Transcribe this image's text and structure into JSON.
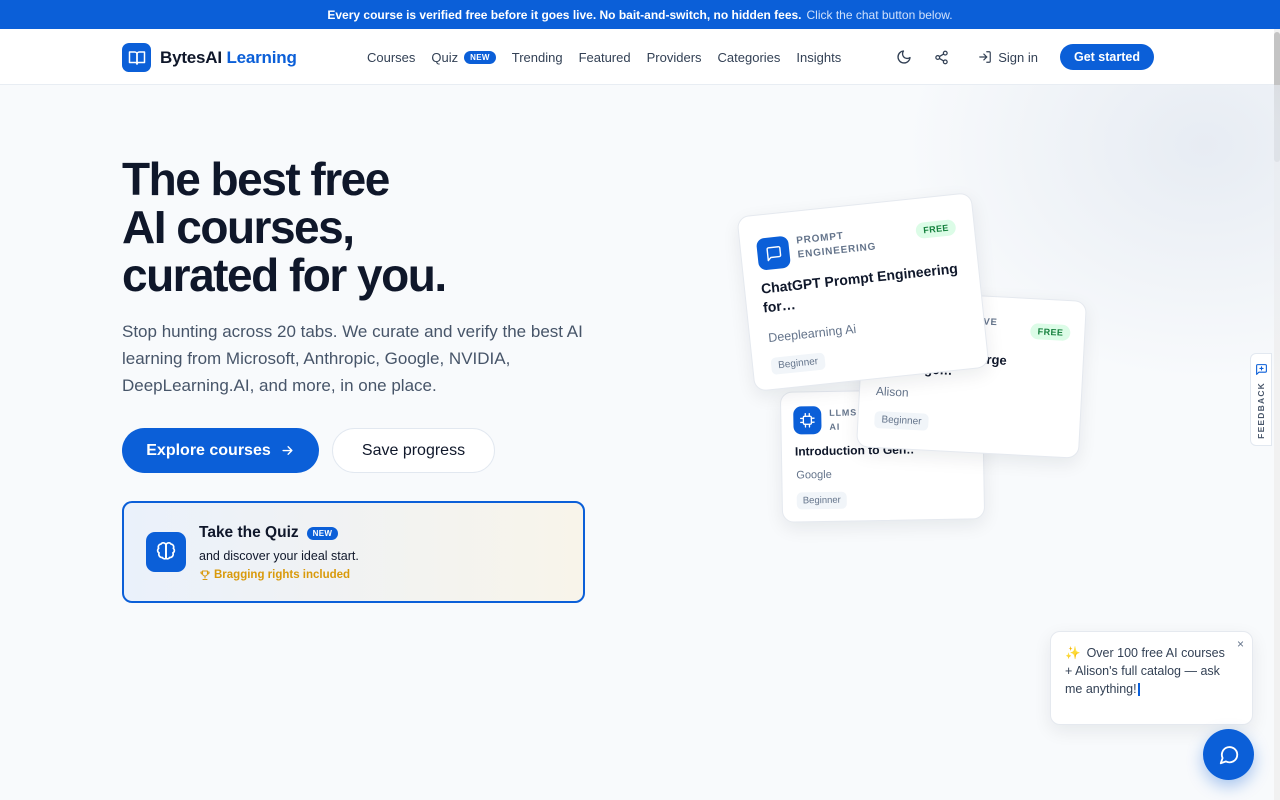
{
  "announcement": {
    "main": "Every course is verified free before it goes live. No bait-and-switch, no hidden fees.",
    "sub": "Click the chat button below."
  },
  "brand": {
    "name": "BytesAI",
    "accent": "Learning"
  },
  "nav": {
    "items": [
      {
        "label": "Courses"
      },
      {
        "label": "Quiz",
        "badge": "NEW"
      },
      {
        "label": "Trending"
      },
      {
        "label": "Featured"
      },
      {
        "label": "Providers"
      },
      {
        "label": "Categories"
      },
      {
        "label": "Insights"
      }
    ],
    "sign_in": "Sign in",
    "get_started": "Get started"
  },
  "hero": {
    "title_lines": [
      "The best free",
      "AI courses,",
      "curated for you."
    ],
    "lead": "Stop hunting across 20 tabs. We curate and verify the best AI learning from Microsoft, Anthropic, Google, NVIDIA, DeepLearning.AI, and more, in one place.",
    "explore": "Explore courses",
    "save": "Save progress"
  },
  "quiz_card": {
    "title": "Take the Quiz",
    "badge": "NEW",
    "subtitle": "and discover your ideal start.",
    "perk": "Bragging rights included"
  },
  "course_cards": [
    {
      "category_line1": "PROMPT",
      "category_line2": "ENGINEERING",
      "free": "FREE",
      "title": "ChatGPT Prompt Engineering for…",
      "provider": "Deeplearning Ai",
      "level": "Beginner"
    },
    {
      "category": "RATIVE",
      "free": "FREE",
      "title_tail": "d Large",
      "title_line2": "guage…",
      "provider": "Alison",
      "level": "Beginner"
    },
    {
      "category_line1": "LLMS",
      "category_line2": "AI",
      "title": "Introduction to Gen…",
      "provider": "Google",
      "level": "Beginner"
    }
  ],
  "feedback": {
    "label": "FEEDBACK"
  },
  "chat": {
    "message": "Over 100 free AI courses + Alison's full catalog — ask me anything!",
    "close": "×"
  },
  "colors": {
    "brand_blue": "#0b5fd8",
    "free_green_bg": "#dcfce7",
    "free_green_text": "#15803d",
    "perk_gold": "#d99a0b"
  },
  "icons": {
    "logo": "open-book-icon",
    "theme": "moon-icon",
    "share": "share-icon",
    "sign_in": "login-arrow-icon",
    "explore": "arrow-right-icon",
    "quiz": "brain-icon",
    "perk": "trophy-icon",
    "card1": "message-square-icon",
    "card3": "chip-icon",
    "feedback": "message-plus-icon",
    "chat": "chat-bubble-icon"
  }
}
